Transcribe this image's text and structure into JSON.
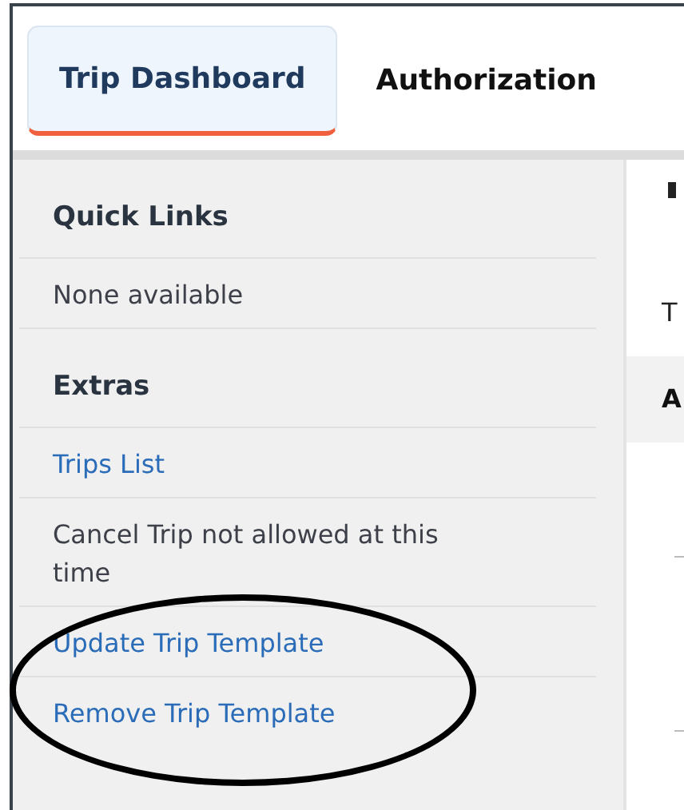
{
  "tabs": [
    {
      "label": "Trip Dashboard",
      "selected": true
    },
    {
      "label": "Authorization",
      "selected": false
    }
  ],
  "sidebar": {
    "sections": [
      {
        "title": "Quick Links",
        "items": [
          {
            "label": "None available",
            "kind": "text"
          }
        ]
      },
      {
        "title": "Extras",
        "items": [
          {
            "label": "Trips List",
            "kind": "link"
          },
          {
            "label": "Cancel Trip not allowed at this time",
            "kind": "text"
          },
          {
            "label": "Update Trip Template",
            "kind": "link"
          },
          {
            "label": "Remove Trip Template",
            "kind": "link"
          }
        ]
      }
    ]
  },
  "main": {
    "label": "T",
    "header": "A"
  }
}
